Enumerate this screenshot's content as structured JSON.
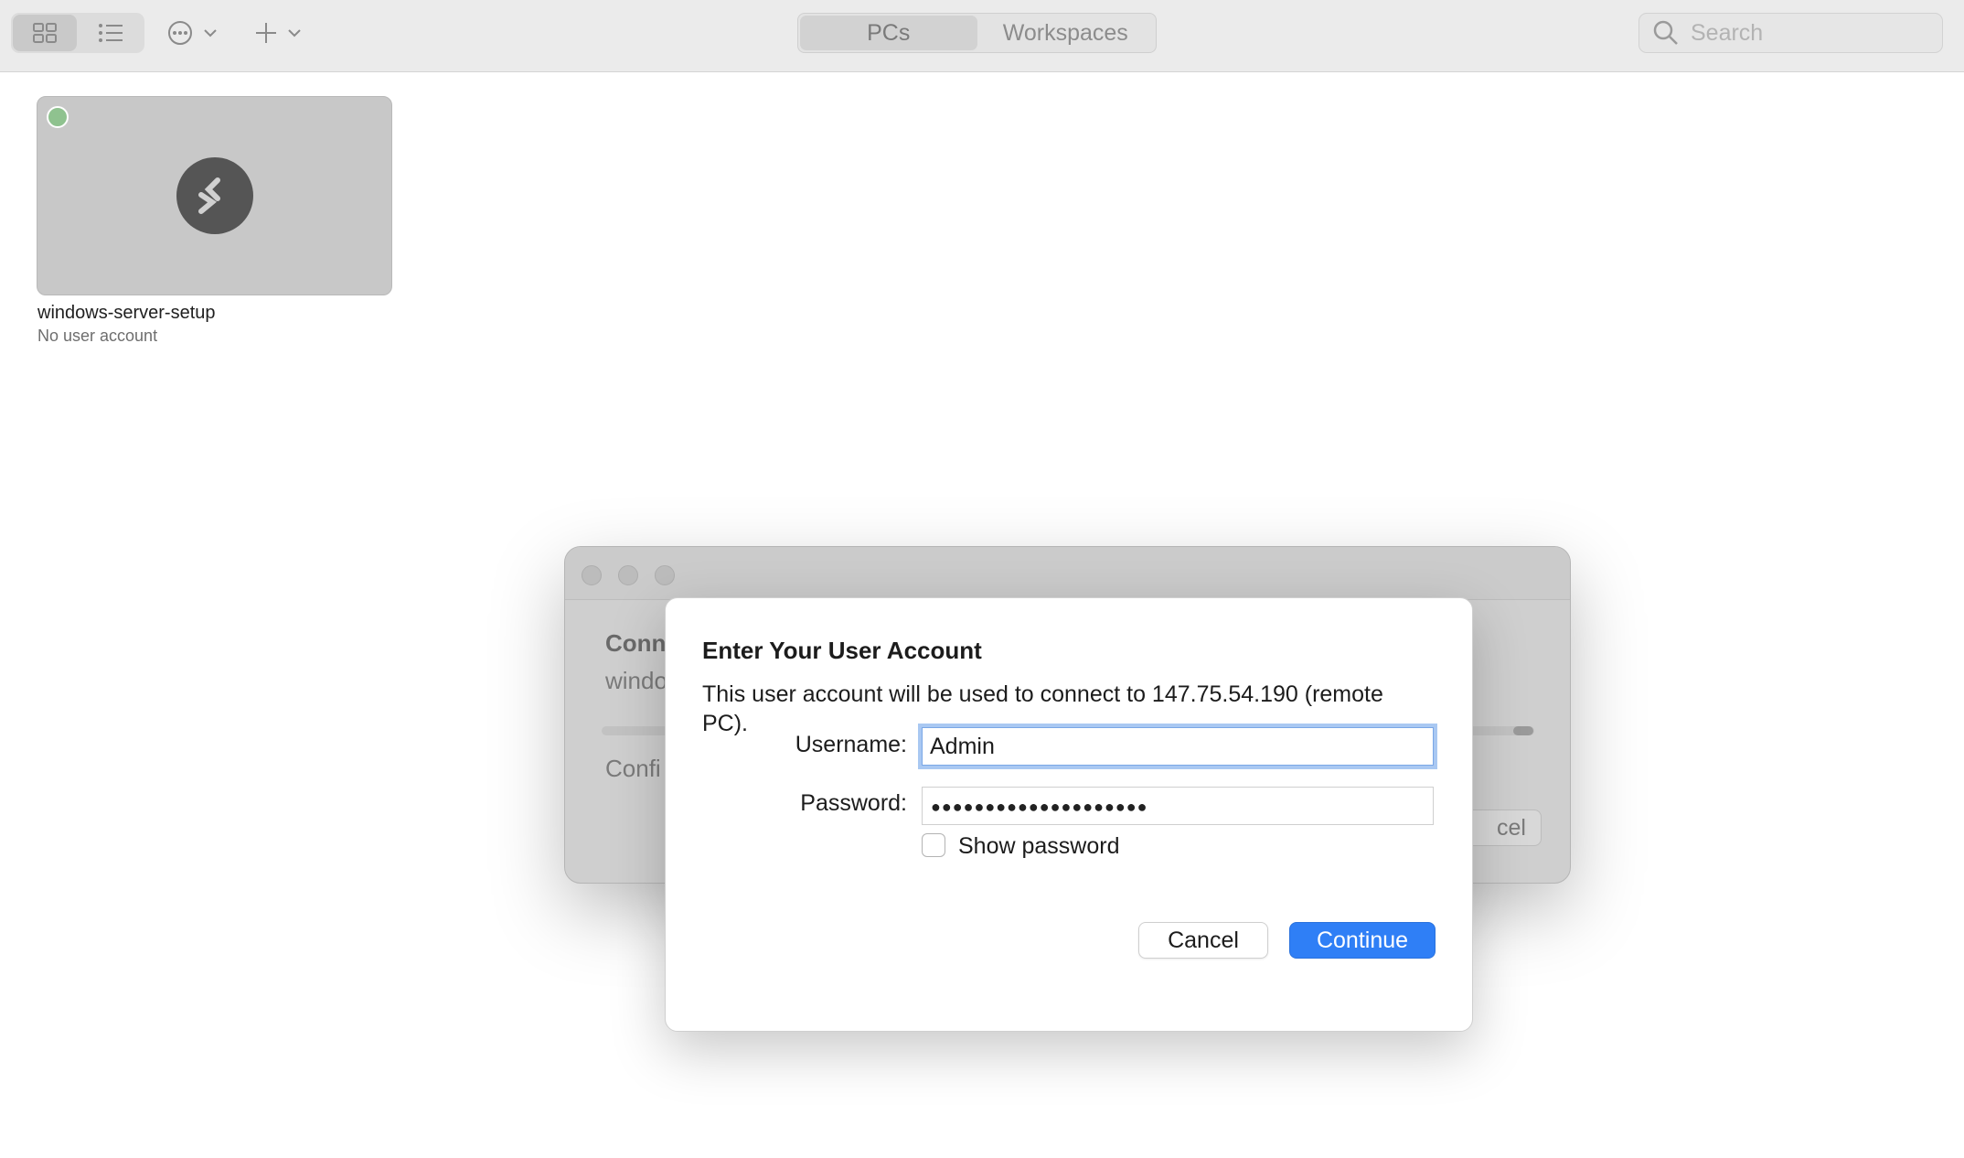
{
  "toolbar": {
    "view_grid_icon": "grid-icon",
    "view_list_icon": "list-icon",
    "more_icon": "ellipsis-circle-icon",
    "add_icon": "plus-icon",
    "tabs": [
      {
        "label": "PCs",
        "active": true
      },
      {
        "label": "Workspaces",
        "active": false
      }
    ],
    "search_placeholder": "Search"
  },
  "pcs": [
    {
      "name": "windows-server-setup",
      "subtitle": "No user account",
      "status_color": "#8fc28f"
    }
  ],
  "background_window": {
    "title_partial": "Conn",
    "subtitle_partial": "windo",
    "status_partial": "Confi",
    "cancel_partial": "cel"
  },
  "dialog": {
    "title": "Enter Your User Account",
    "description": "This user account will be used to connect to 147.75.54.190 (remote PC).",
    "username_label": "Username:",
    "username_value": "Admin",
    "password_label": "Password:",
    "password_masked": "●●●●●●●●●●●●●●●●●●●●",
    "show_password_label": "Show password",
    "show_password_checked": false,
    "cancel_label": "Cancel",
    "continue_label": "Continue"
  },
  "colors": {
    "accent": "#2f7ff6",
    "focus_ring": "#a9c8f2"
  }
}
